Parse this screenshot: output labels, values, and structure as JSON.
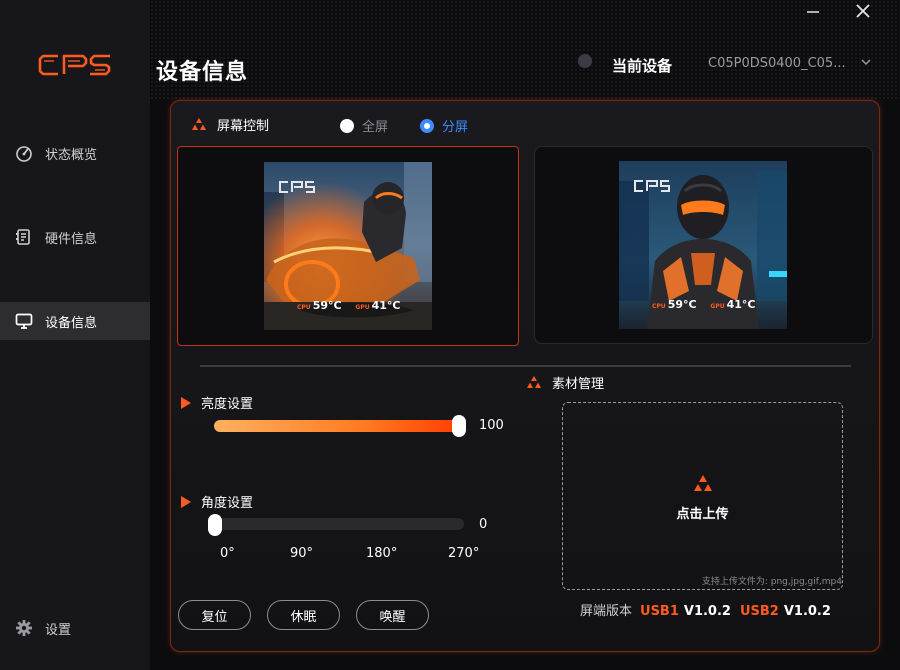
{
  "app": {
    "logo_text": "CPS",
    "accent": "#ff5a1f",
    "window_controls": {
      "minimize": "minimize-icon",
      "close": "close-icon"
    }
  },
  "sidebar": {
    "items": [
      {
        "label": "状态概览",
        "icon": "dashboard-icon",
        "active": false
      },
      {
        "label": "硬件信息",
        "icon": "hardware-icon",
        "active": false
      },
      {
        "label": "设备信息",
        "icon": "monitor-icon",
        "active": true
      }
    ],
    "settings": {
      "label": "设置",
      "icon": "gear-icon"
    }
  },
  "header": {
    "title": "设备信息",
    "device_label": "当前设备",
    "device_value": "C05P0DS0400_C05..."
  },
  "screen_control": {
    "title": "屏幕控制",
    "modes": [
      {
        "label": "全屏",
        "selected": false
      },
      {
        "label": "分屏",
        "selected": true
      }
    ],
    "screens": [
      {
        "logo": "CPS",
        "cpu_label": "CPU",
        "cpu_temp": "59°C",
        "gpu_label": "GPU",
        "gpu_temp": "41°C",
        "selected": true
      },
      {
        "logo": "CPS",
        "cpu_label": "CPU",
        "cpu_temp": "59°C",
        "gpu_label": "GPU",
        "gpu_temp": "41°C",
        "selected": false
      }
    ]
  },
  "brightness": {
    "title": "亮度设置",
    "value": "100",
    "level": 1.0
  },
  "angle": {
    "title": "角度设置",
    "value": "0",
    "level": 0.0,
    "ticks": [
      "0°",
      "90°",
      "180°",
      "270°"
    ]
  },
  "material": {
    "title": "素材管理",
    "upload_label": "点击上传",
    "hint": "支持上传文件为: png,jpg,gif,mp4"
  },
  "version": {
    "label": "屏端版本",
    "usb1_label": "USB1",
    "usb1_version": "V1.0.2",
    "usb2_label": "USB2",
    "usb2_version": "V1.0.2"
  },
  "actions": {
    "reset": "复位",
    "sleep": "休眠",
    "wake": "唤醒"
  }
}
